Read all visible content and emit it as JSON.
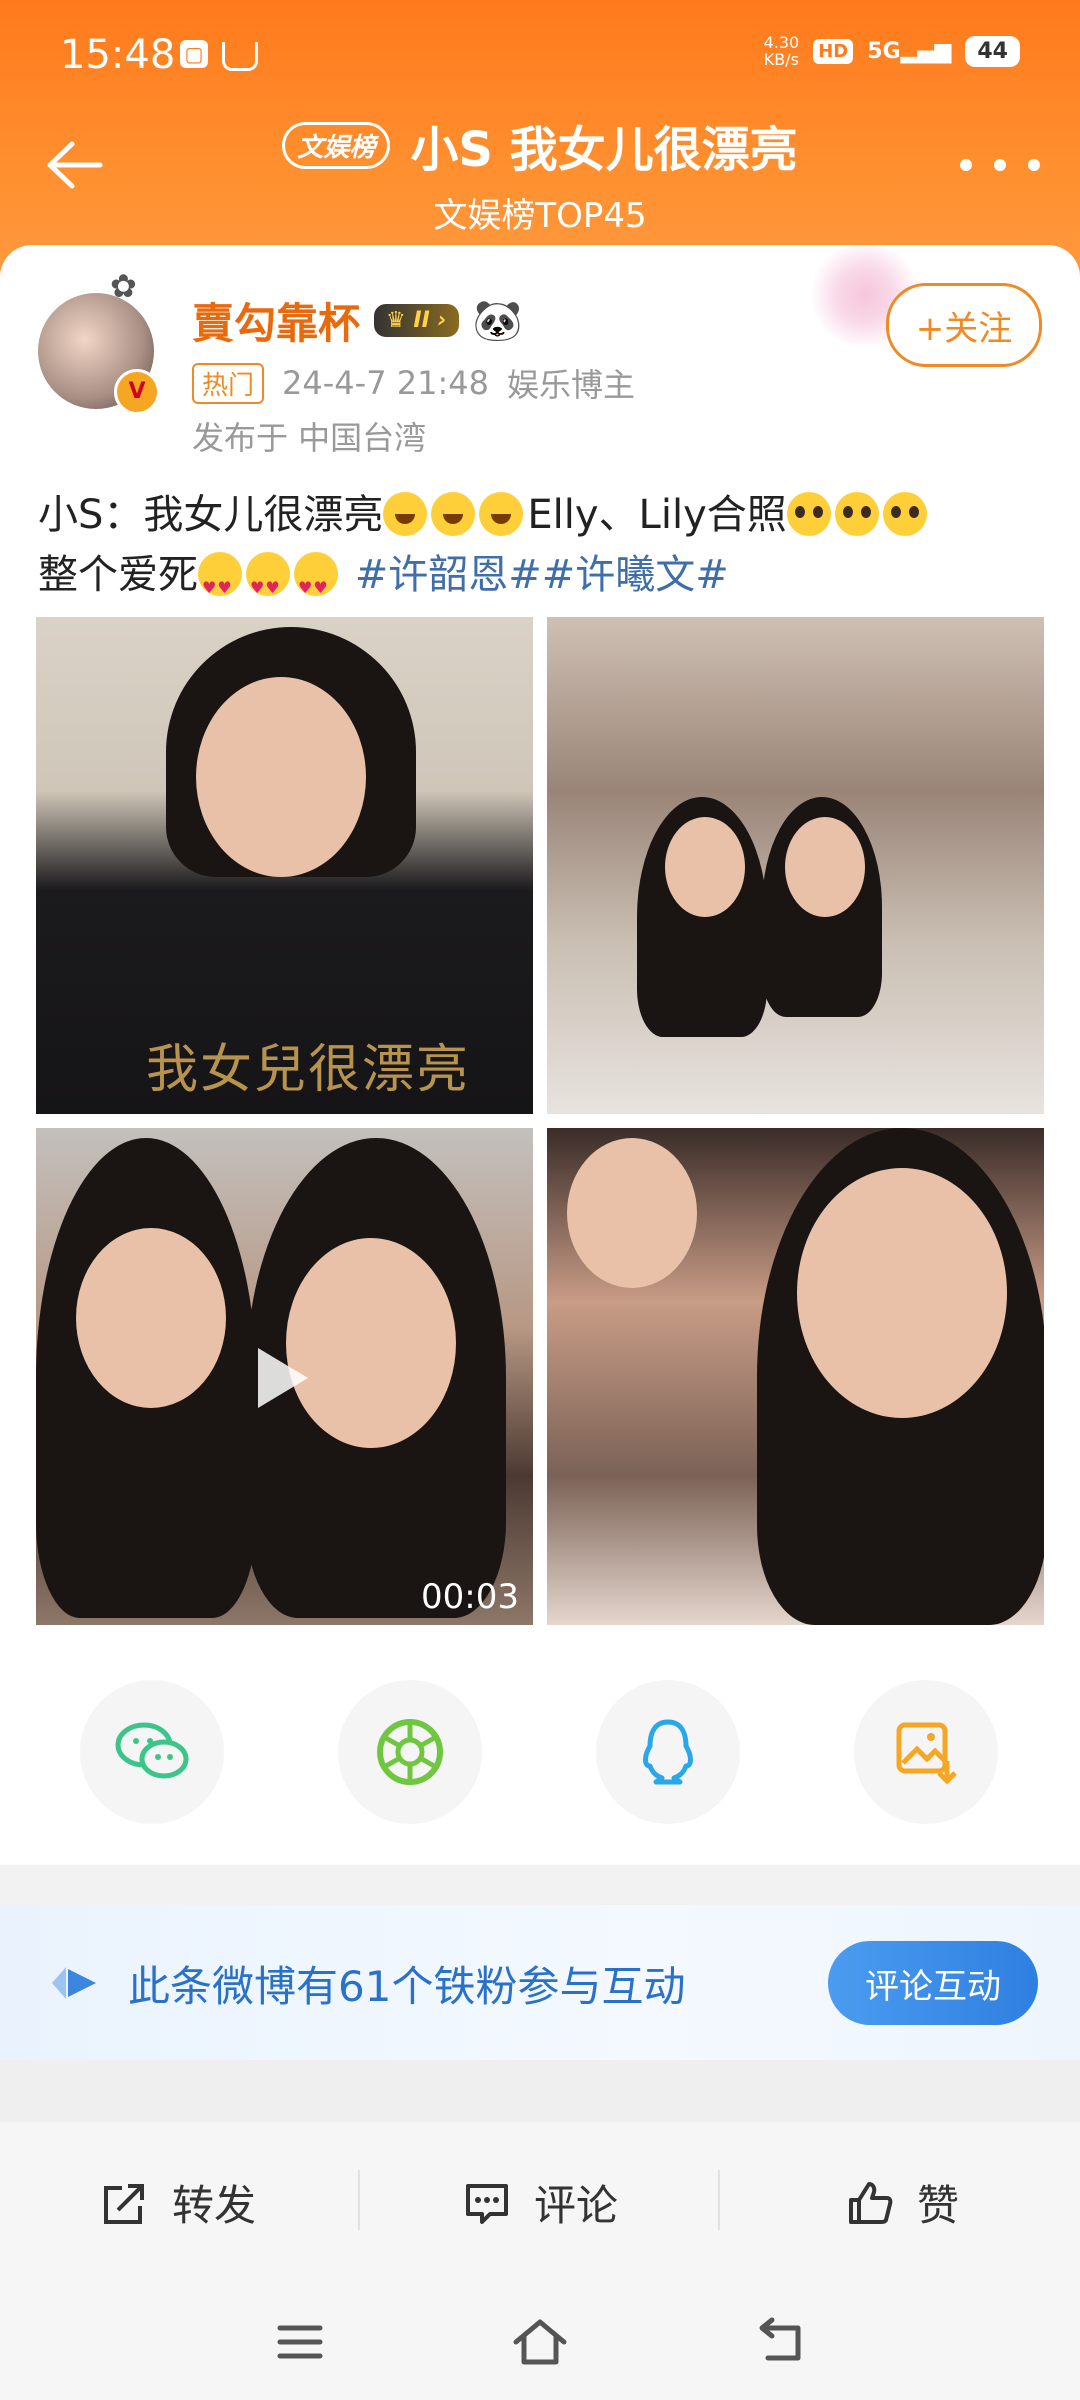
{
  "status": {
    "time": "15:48",
    "speed_top": "4.30",
    "speed_unit": "KB/s",
    "hd": "HD",
    "network": "5G",
    "battery": "44"
  },
  "header": {
    "badge": "文娱榜",
    "title": "小S 我女儿很漂亮",
    "subtitle": "文娱榜TOP45"
  },
  "post": {
    "username": "賣勾靠杯",
    "vip_level": "II",
    "hot_label": "热门",
    "datetime": "24-4-7 21:48",
    "author_role": "娱乐博主",
    "location": "发布于 中国台湾",
    "follow_label": "+关注",
    "text_part1": "小S：我女儿很漂亮",
    "text_part2": "Elly、Lily合照",
    "text_part3": "整个爱死",
    "hashtags": "#许韶恩##许曦文#",
    "shirt_text": "我女兒很漂亮",
    "video_duration": "00:03"
  },
  "share": [
    {
      "name": "wechat-icon"
    },
    {
      "name": "moments-icon"
    },
    {
      "name": "qq-icon"
    },
    {
      "name": "save-image-icon"
    }
  ],
  "banner": {
    "text": "此条微博有61个铁粉参与互动",
    "button": "评论互动"
  },
  "actions": {
    "repost": "转发",
    "comment": "评论",
    "like": "赞"
  },
  "colors": {
    "header": "#ff7a1c",
    "username": "#e96a0d",
    "hashtag": "#3f6ea8",
    "banner_text": "#2a72c9"
  }
}
